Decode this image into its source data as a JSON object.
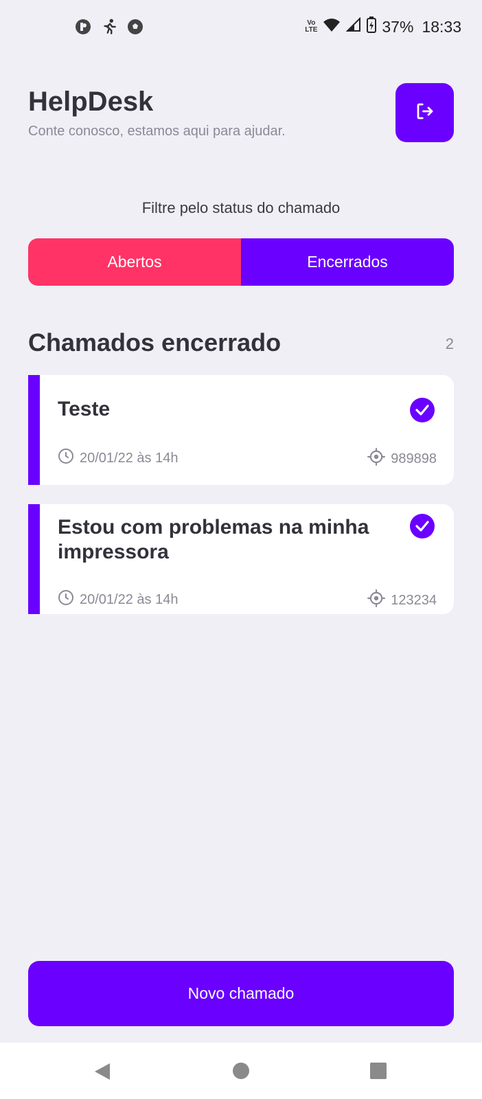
{
  "status_bar": {
    "battery": "37%",
    "time": "18:33",
    "network_top": "Vo",
    "network_bottom": "LTE"
  },
  "header": {
    "title": "HelpDesk",
    "subtitle": "Conte conosco, estamos aqui para ajudar."
  },
  "filter": {
    "label": "Filtre pelo status do chamado",
    "tabs": [
      {
        "label": "Abertos"
      },
      {
        "label": "Encerrados"
      }
    ]
  },
  "section": {
    "title": "Chamados encerrado",
    "count": "2"
  },
  "tickets": [
    {
      "title": "Teste",
      "datetime": "20/01/22 às 14h",
      "id": "989898"
    },
    {
      "title": "Estou com problemas na minha impressora",
      "datetime": "20/01/22 às 14h",
      "id": "123234"
    }
  ],
  "actions": {
    "new_ticket": "Novo chamado"
  },
  "colors": {
    "primary": "#6A00FF",
    "open": "#FF3366",
    "background": "#F0EFF6"
  },
  "icons": [
    "logout-icon",
    "check-circle-icon",
    "clock-icon",
    "gps-target-icon",
    "back-icon",
    "home-icon",
    "recents-icon"
  ]
}
